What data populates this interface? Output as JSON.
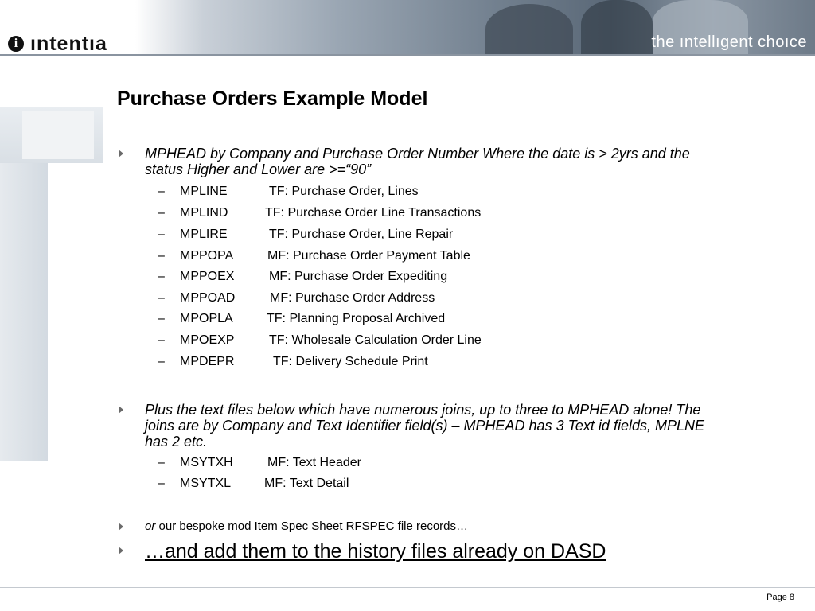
{
  "header": {
    "logo_text": "ıntentıa",
    "logo_mark": "i",
    "tagline": "the ıntellıgent choıce"
  },
  "title": "Purchase Orders Example Model",
  "bullets": {
    "b1_line1": "MPHEAD by Company and Purchase Order Number Where the date is > 2yrs and the",
    "b1_line2": "status Higher and Lower are >=“90”",
    "b2_line1": "Plus the text files below which have numerous joins, up to three to MPHEAD alone!  The",
    "b2_line2": "joins are by Company and Text Identifier field(s) – MPHEAD has 3 Text id fields, MPLNE",
    "b2_line3": "has 2 etc.",
    "b3_or": "or",
    "b3_rest": " our bespoke mod Item Spec Sheet RFSPEC file records…",
    "b4": "…and add them to the history files already on DASD"
  },
  "files_group1": [
    {
      "code": "MPLINE",
      "desc": "TF:  Purchase Order, Lines"
    },
    {
      "code": "MPLIND",
      "desc": "TF:  Purchase Order Line Transactions"
    },
    {
      "code": "MPLIRE",
      "desc": "TF:  Purchase Order, Line Repair"
    },
    {
      "code": "MPPOPA",
      "desc": "MF:  Purchase Order Payment Table"
    },
    {
      "code": "MPPOEX",
      "desc": "MF:  Purchase Order Expediting"
    },
    {
      "code": "MPPOAD",
      "desc": "MF:  Purchase Order Address"
    },
    {
      "code": "MPOPLA",
      "desc": "TF:  Planning Proposal Archived"
    },
    {
      "code": "MPOEXP",
      "desc": "TF:  Wholesale Calculation Order Line"
    },
    {
      "code": "MPDEPR",
      "desc": "TF:  Delivery Schedule Print"
    }
  ],
  "files_group2": [
    {
      "code": "MSYTXH",
      "desc": "MF:  Text Header"
    },
    {
      "code": "MSYTXL",
      "desc": "MF:  Text Detail"
    }
  ],
  "dash": "–",
  "footer": {
    "page": "Page 8"
  }
}
